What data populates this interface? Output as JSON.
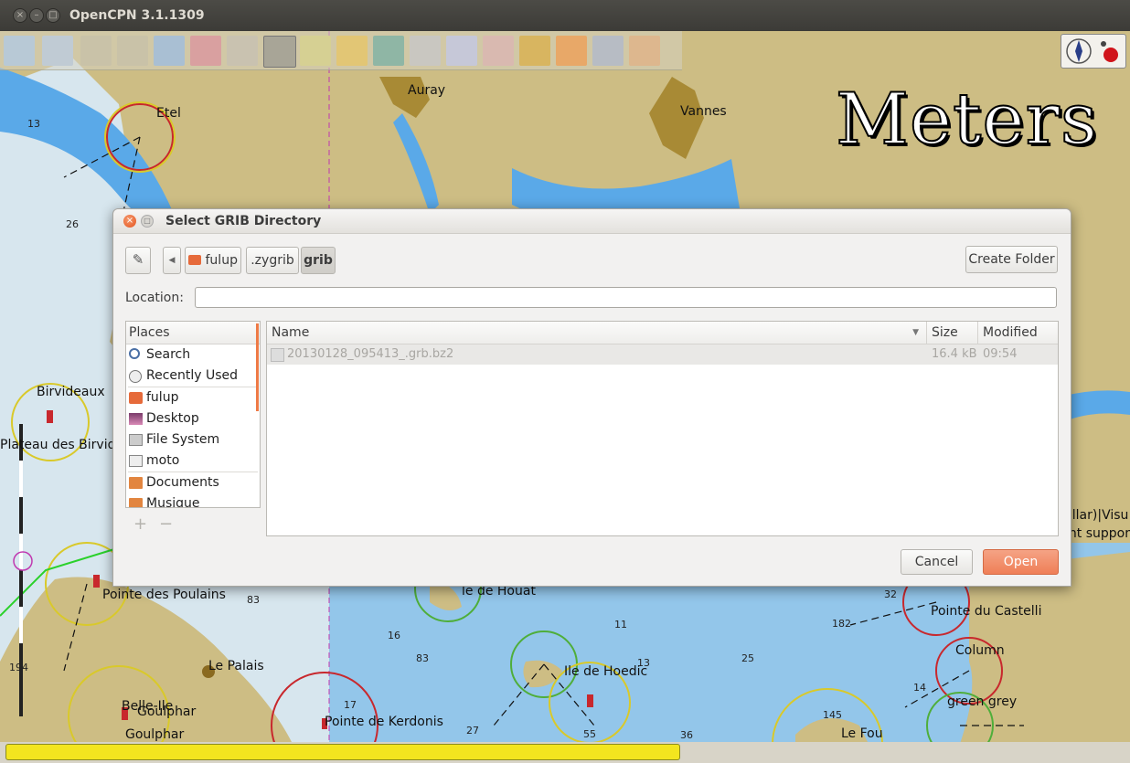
{
  "window": {
    "title": "OpenCPN 3.1.1309"
  },
  "map": {
    "overlay_text": "Meters",
    "place_labels": [
      "Etel",
      "Auray",
      "Vannes",
      "Birvideaux",
      "Plateau des Birvide",
      "Pointe des Poulains",
      "Le Palais",
      "Belle-Ile",
      "Goulphar",
      "Goulphar",
      "Pointe de Kerdonis",
      "le de Houat",
      "Ile de Hoedic",
      "Pointe du Castelli",
      "Column",
      "green grey",
      "Le Fou",
      "pillar)|Visu",
      "ght suppor"
    ],
    "depths": [
      "13",
      "26",
      "83",
      "16",
      "83",
      "11",
      "13",
      "25",
      "17",
      "27",
      "55",
      "36",
      "182",
      "32",
      "14",
      "145",
      "194"
    ]
  },
  "toolbar": {
    "icons": [
      "zoom-in-icon",
      "zoom-out-icon",
      "scale-down-icon",
      "scale-up-icon",
      "route-icon",
      "measure-icon",
      "settings-icon",
      "text-icon",
      "ais-icon",
      "current-icon",
      "tide-icon",
      "print-icon",
      "route-manager-icon",
      "track-icon",
      "color-scheme-icon",
      "mob-icon",
      "help-icon",
      "plugin-icon"
    ]
  },
  "status": {
    "progress": 1.0
  },
  "dialog": {
    "title": "Select GRIB Directory",
    "path": [
      "fulup",
      ".zygrib",
      "grib"
    ],
    "active_path": "grib",
    "create_folder": "Create Folder",
    "location_label": "Location:",
    "location_value": "",
    "places_header": "Places",
    "places": [
      {
        "label": "Search",
        "icon": "search-icon"
      },
      {
        "label": "Recently Used",
        "icon": "clock-icon"
      },
      {
        "label": "fulup",
        "icon": "home-folder-icon"
      },
      {
        "label": "Desktop",
        "icon": "desktop-icon"
      },
      {
        "label": "File System",
        "icon": "drive-icon"
      },
      {
        "label": "moto",
        "icon": "removable-drive-icon"
      },
      {
        "label": "Documents",
        "icon": "folder-icon"
      },
      {
        "label": "Musique",
        "icon": "folder-icon"
      }
    ],
    "columns": {
      "name": "Name",
      "size": "Size",
      "modified": "Modified"
    },
    "files": [
      {
        "name": "20130128_095413_.grb.bz2",
        "size": "16.4 kB",
        "modified": "09:54"
      }
    ],
    "add_symbol": "+",
    "remove_symbol": "−",
    "cancel": "Cancel",
    "open": "Open"
  }
}
